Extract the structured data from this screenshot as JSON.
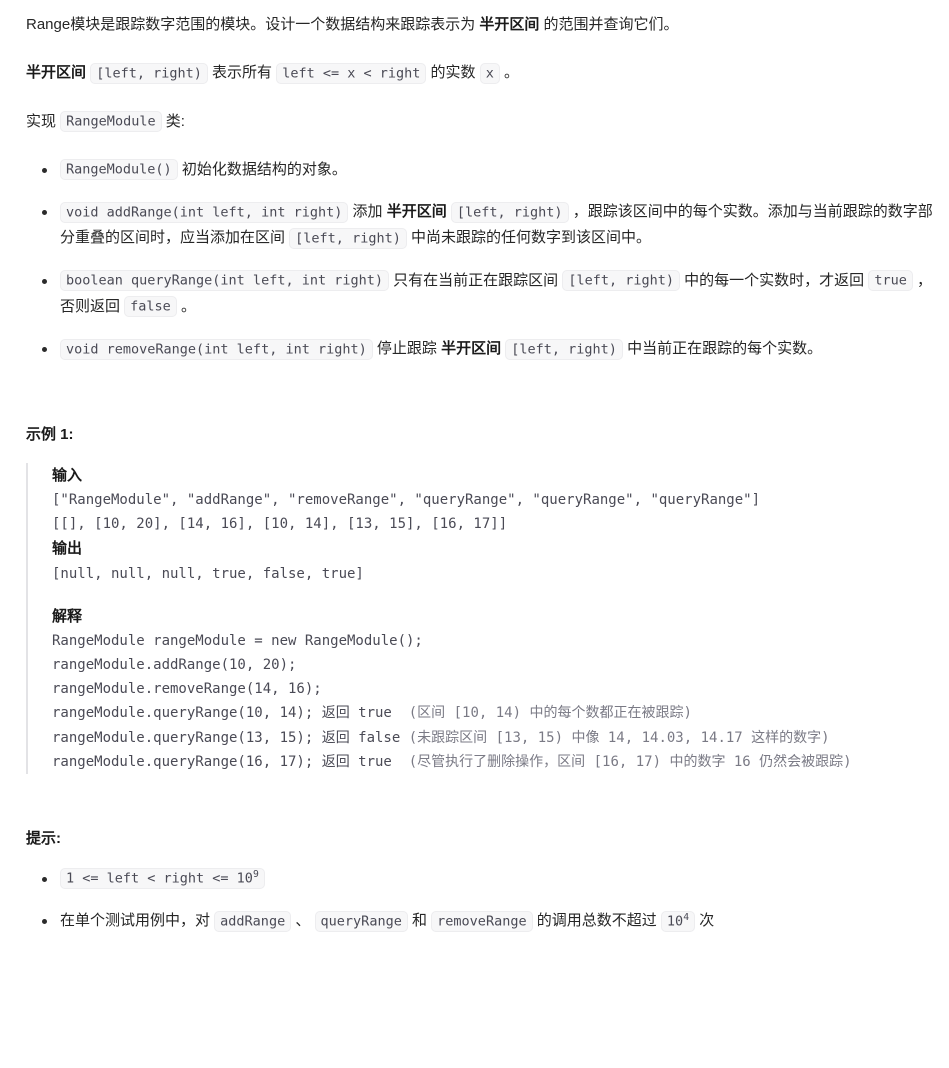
{
  "intro": {
    "line1_a": "Range模块是跟踪数字范围的模块。设计一个数据结构来跟踪表示为 ",
    "line1_bold": "半开区间",
    "line1_b": " 的范围并查询它们。",
    "line2_bold": "半开区间",
    "line2_code1": "[left, right)",
    "line2_a": " 表示所有 ",
    "line2_code2": "left <= x < right",
    "line2_b": " 的实数 ",
    "line2_code3": "x",
    "line2_c": " 。",
    "line3_a": "实现 ",
    "line3_code": "RangeModule",
    "line3_b": " 类:"
  },
  "methods": [
    {
      "code": "RangeModule()",
      "text_after": " 初始化数据结构的对象。"
    },
    {
      "code": "void addRange(int left, int right)",
      "t1": " 添加 ",
      "bold": "半开区间",
      "code2": "[left, right)",
      "t2": " ，跟踪该区间中的每个实数。添加与当前跟踪的数字部分重叠的区间时，应当添加在区间 ",
      "code3": "[left, right)",
      "t3": " 中尚未跟踪的任何数字到该区间中。"
    },
    {
      "code": "boolean queryRange(int left, int right)",
      "t1": " 只有在当前正在跟踪区间 ",
      "code2": "[left, right)",
      "t2": " 中的每一个实数时，才返回 ",
      "code3": "true",
      "t3": " ，否则返回 ",
      "code4": "false",
      "t4": " 。"
    },
    {
      "code": "void removeRange(int left, int right)",
      "t1": " 停止跟踪 ",
      "bold": "半开区间",
      "code2": "[left, right)",
      "t2": " 中当前正在跟踪的每个实数。"
    }
  ],
  "example": {
    "title": "示例 1:",
    "input_label": "输入",
    "input_line1": "[\"RangeModule\", \"addRange\", \"removeRange\", \"queryRange\", \"queryRange\", \"queryRange\"]",
    "input_line2": "[[], [10, 20], [14, 16], [10, 14], [13, 15], [16, 17]]",
    "output_label": "输出",
    "output_line": "[null, null, null, true, false, true]",
    "explain_label": "解释",
    "explain_lines": [
      "RangeModule rangeModule = new RangeModule();",
      "rangeModule.addRange(10, 20);",
      "rangeModule.removeRange(14, 16);"
    ],
    "explain_q1_code": "rangeModule.queryRange(10, 14); 返回 true ",
    "explain_q1_note": " (区间 [10, 14) 中的每个数都正在被跟踪)",
    "explain_q2_code": "rangeModule.queryRange(13, 15); 返回 false",
    "explain_q2_note": " (未跟踪区间 [13, 15) 中像 14, 14.03, 14.17 这样的数字)",
    "explain_q3_code": "rangeModule.queryRange(16, 17); 返回 true ",
    "explain_q3_note": " (尽管执行了删除操作，区间 [16, 17) 中的数字 16 仍然会被跟踪)"
  },
  "hints": {
    "title": "提示:",
    "hint1_code_pre": "1 <= left < right <= 10",
    "hint1_code_sup": "9",
    "hint2_a": "在单个测试用例中，对 ",
    "hint2_code1": "addRange",
    "hint2_b": " 、 ",
    "hint2_code2": "queryRange",
    "hint2_c": " 和 ",
    "hint2_code3": "removeRange",
    "hint2_d": " 的调用总数不超过 ",
    "hint2_code4_pre": "10",
    "hint2_code4_sup": "4",
    "hint2_e": " 次"
  }
}
